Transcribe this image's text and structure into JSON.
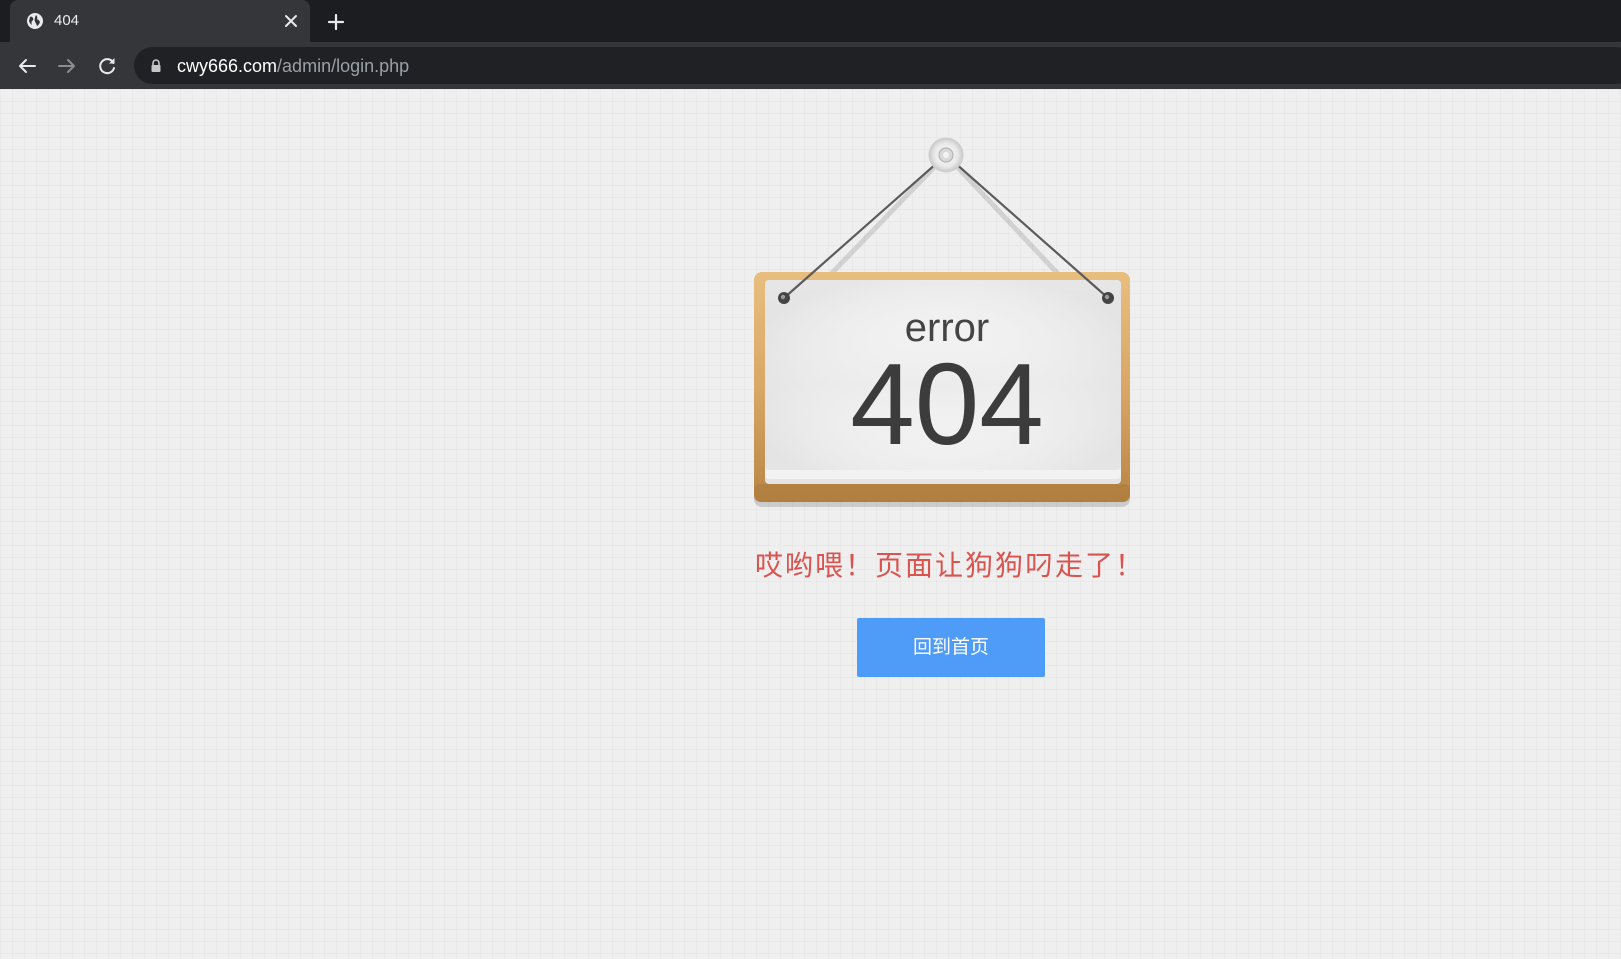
{
  "browser": {
    "tab": {
      "title": "404",
      "icon": "globe-icon",
      "close_icon": "close-icon"
    },
    "new_tab_icon": "plus-icon",
    "nav": {
      "back_icon": "back-arrow-icon",
      "forward_icon": "forward-arrow-icon",
      "reload_icon": "reload-icon"
    },
    "address_bar": {
      "lock_icon": "lock-icon",
      "url_host": "cwy666.com",
      "url_path": "/admin/login.php"
    }
  },
  "page": {
    "sign": {
      "label": "error",
      "code": "404"
    },
    "message": "哎哟喂！页面让狗狗叼走了！",
    "home_button": "回到首页"
  },
  "colors": {
    "message": "#d9534f",
    "button": "#4f9bf8",
    "page_background": "#efefef",
    "board_wood": "#d9a766"
  }
}
